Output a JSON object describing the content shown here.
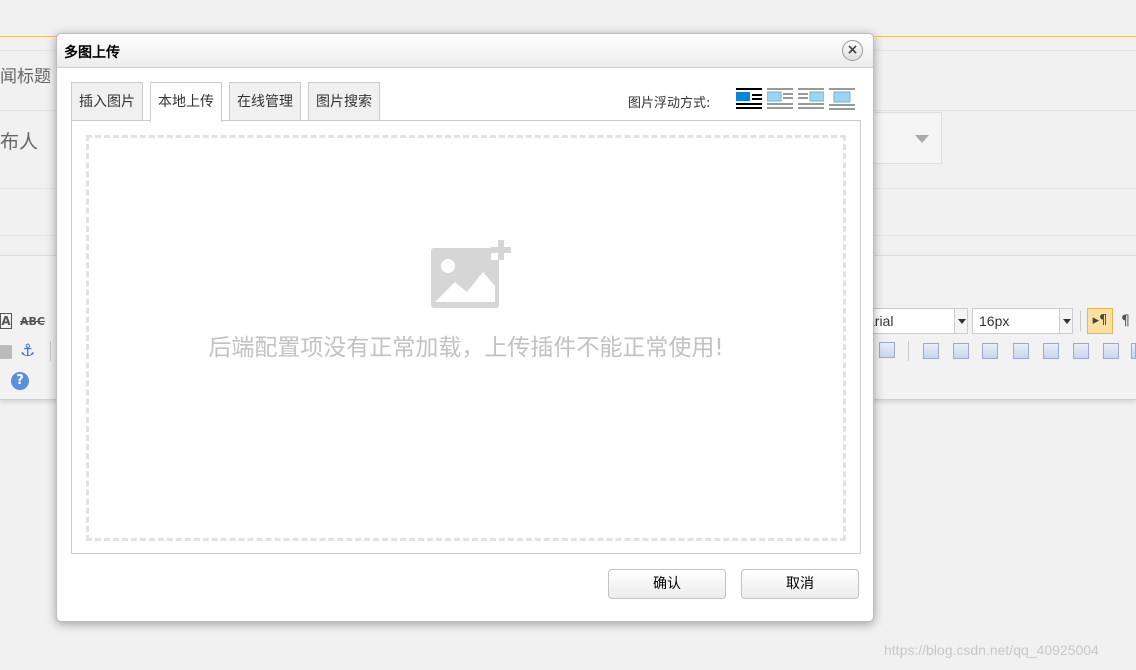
{
  "background": {
    "news_title_label": "闻标题",
    "publisher_label": "布人",
    "font_family_value": "arial",
    "font_size_value": "16px",
    "help_icon": "?",
    "paragraph_mark": "▸¶",
    "left_tools": [
      "A",
      "ABC",
      "⚓"
    ]
  },
  "dialog": {
    "title": "多图上传",
    "close_glyph": "×",
    "tabs": [
      {
        "label": "插入图片",
        "active": false
      },
      {
        "label": "本地上传",
        "active": true
      },
      {
        "label": "在线管理",
        "active": false
      },
      {
        "label": "图片搜索",
        "active": false
      }
    ],
    "float_label": "图片浮动方式:",
    "float_options": [
      "float-none-icon",
      "float-left-icon",
      "float-right-icon",
      "float-center-icon"
    ],
    "upload_error": "后端配置项没有正常加载，上传插件不能正常使用!",
    "confirm_label": "确认",
    "cancel_label": "取消"
  },
  "watermark": "https://blog.csdn.net/qq_40925004",
  "colors": {
    "accent_line": "#f0c36d",
    "float_active": "#0078d7",
    "float_idle": "#9fd4f0"
  }
}
